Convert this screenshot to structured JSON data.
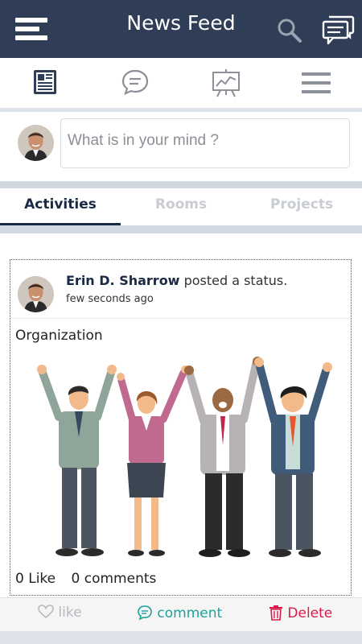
{
  "header": {
    "title": "News Feed",
    "menu_icon": "hamburger-menu-icon",
    "search_icon": "search-icon",
    "messages_icon": "messages-icon"
  },
  "nav_icons": [
    "newspaper-icon",
    "chat-bubble-icon",
    "chart-board-icon",
    "menu-lines-icon"
  ],
  "composer": {
    "placeholder": "What is in your mind ?"
  },
  "tabs": [
    {
      "label": "Activities",
      "active": true
    },
    {
      "label": "Rooms",
      "active": false
    },
    {
      "label": "Projects",
      "active": false
    }
  ],
  "post": {
    "author": "Erin D. Sharrow",
    "action": "posted a status.",
    "time": "few seconds ago",
    "text": "Organization",
    "likes": "0 Like",
    "comments": "0 comments"
  },
  "actions": {
    "like": "like",
    "comment": "comment",
    "delete": "Delete"
  },
  "colors": {
    "header_bg": "#2f3e56",
    "tab_active": "#1b2a44",
    "comment": "#1ba39c",
    "delete": "#d81b4a",
    "like": "#b5b9bf"
  }
}
